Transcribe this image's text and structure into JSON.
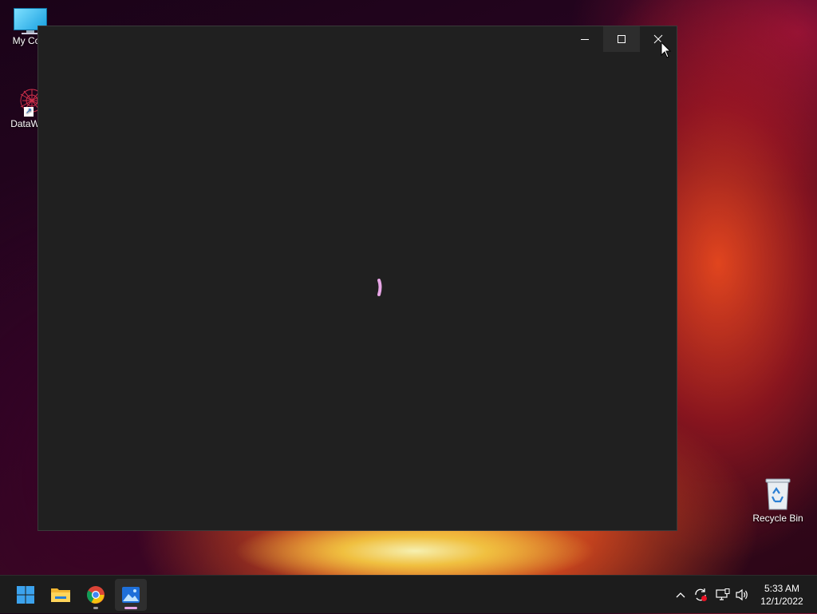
{
  "desktop": {
    "icons": [
      {
        "label": "My Com",
        "icon": "computer-icon"
      },
      {
        "label": "DataWag",
        "icon": "datawagon-icon"
      },
      {
        "label": "Recycle Bin",
        "icon": "recycle-bin-icon"
      }
    ]
  },
  "window": {
    "controls": {
      "minimize_icon": "minimize-icon",
      "maximize_icon": "maximize-icon",
      "close_icon": "close-icon"
    },
    "loading_icon": "loading-spinner-icon",
    "accent_color": "#e8a6e6"
  },
  "taskbar": {
    "apps": [
      {
        "name": "start",
        "icon": "windows-start-icon"
      },
      {
        "name": "file-explorer",
        "icon": "folder-icon"
      },
      {
        "name": "chrome",
        "icon": "chrome-icon"
      },
      {
        "name": "photos",
        "icon": "photos-icon"
      }
    ],
    "tray": {
      "icons": [
        "chevron-up-icon",
        "sync-icon",
        "network-icon",
        "volume-icon"
      ]
    },
    "clock": {
      "time": "5:33 AM",
      "date": "12/1/2022"
    }
  }
}
